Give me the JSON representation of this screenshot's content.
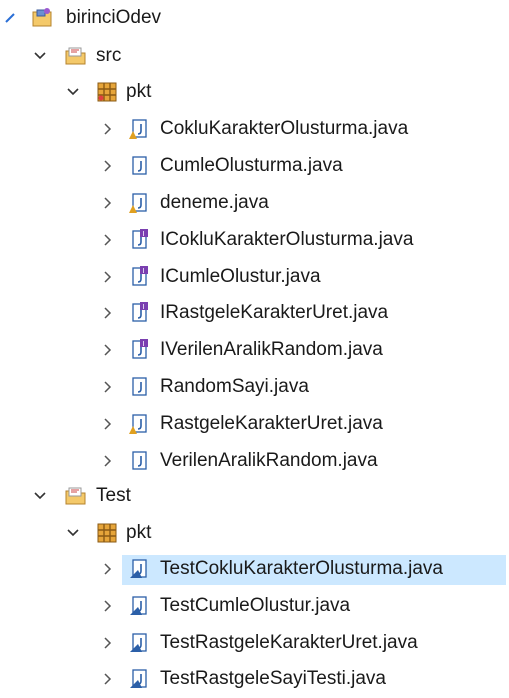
{
  "tree": {
    "project": {
      "label": "birinciOdev",
      "icon": "java-project-icon",
      "expanded": true
    },
    "src": {
      "label": "src",
      "icon": "source-folder-icon",
      "expanded": true,
      "package": {
        "label": "pkt",
        "icon": "package-icon",
        "expanded": true,
        "files": [
          {
            "label": "CokluKarakterOlusturma.java",
            "type": "class-warning"
          },
          {
            "label": "CumleOlusturma.java",
            "type": "class"
          },
          {
            "label": "deneme.java",
            "type": "class-warning"
          },
          {
            "label": "ICokluKarakterOlusturma.java",
            "type": "interface"
          },
          {
            "label": "ICumleOlustur.java",
            "type": "interface"
          },
          {
            "label": "IRastgeleKarakterUret.java",
            "type": "interface"
          },
          {
            "label": "IVerilenAralikRandom.java",
            "type": "interface"
          },
          {
            "label": "RandomSayi.java",
            "type": "class"
          },
          {
            "label": "RastgeleKarakterUret.java",
            "type": "class-warning"
          },
          {
            "label": "VerilenAralikRandom.java",
            "type": "class"
          }
        ]
      }
    },
    "test": {
      "label": "Test",
      "icon": "source-folder-icon",
      "expanded": true,
      "package": {
        "label": "pkt",
        "icon": "package-icon",
        "expanded": true,
        "files": [
          {
            "label": "TestCokluKarakterOlusturma.java",
            "type": "test",
            "selected": true
          },
          {
            "label": "TestCumleOlustur.java",
            "type": "test"
          },
          {
            "label": "TestRastgeleKarakterUret.java",
            "type": "test"
          },
          {
            "label": "TestRastgeleSayiTesti.java",
            "type": "test"
          }
        ]
      }
    }
  },
  "colors": {
    "selection": "#cce8ff",
    "icon_blue": "#2b5fa8",
    "folder": "#e8b54a",
    "warning": "#e0a020",
    "interface": "#7a3fb0"
  }
}
